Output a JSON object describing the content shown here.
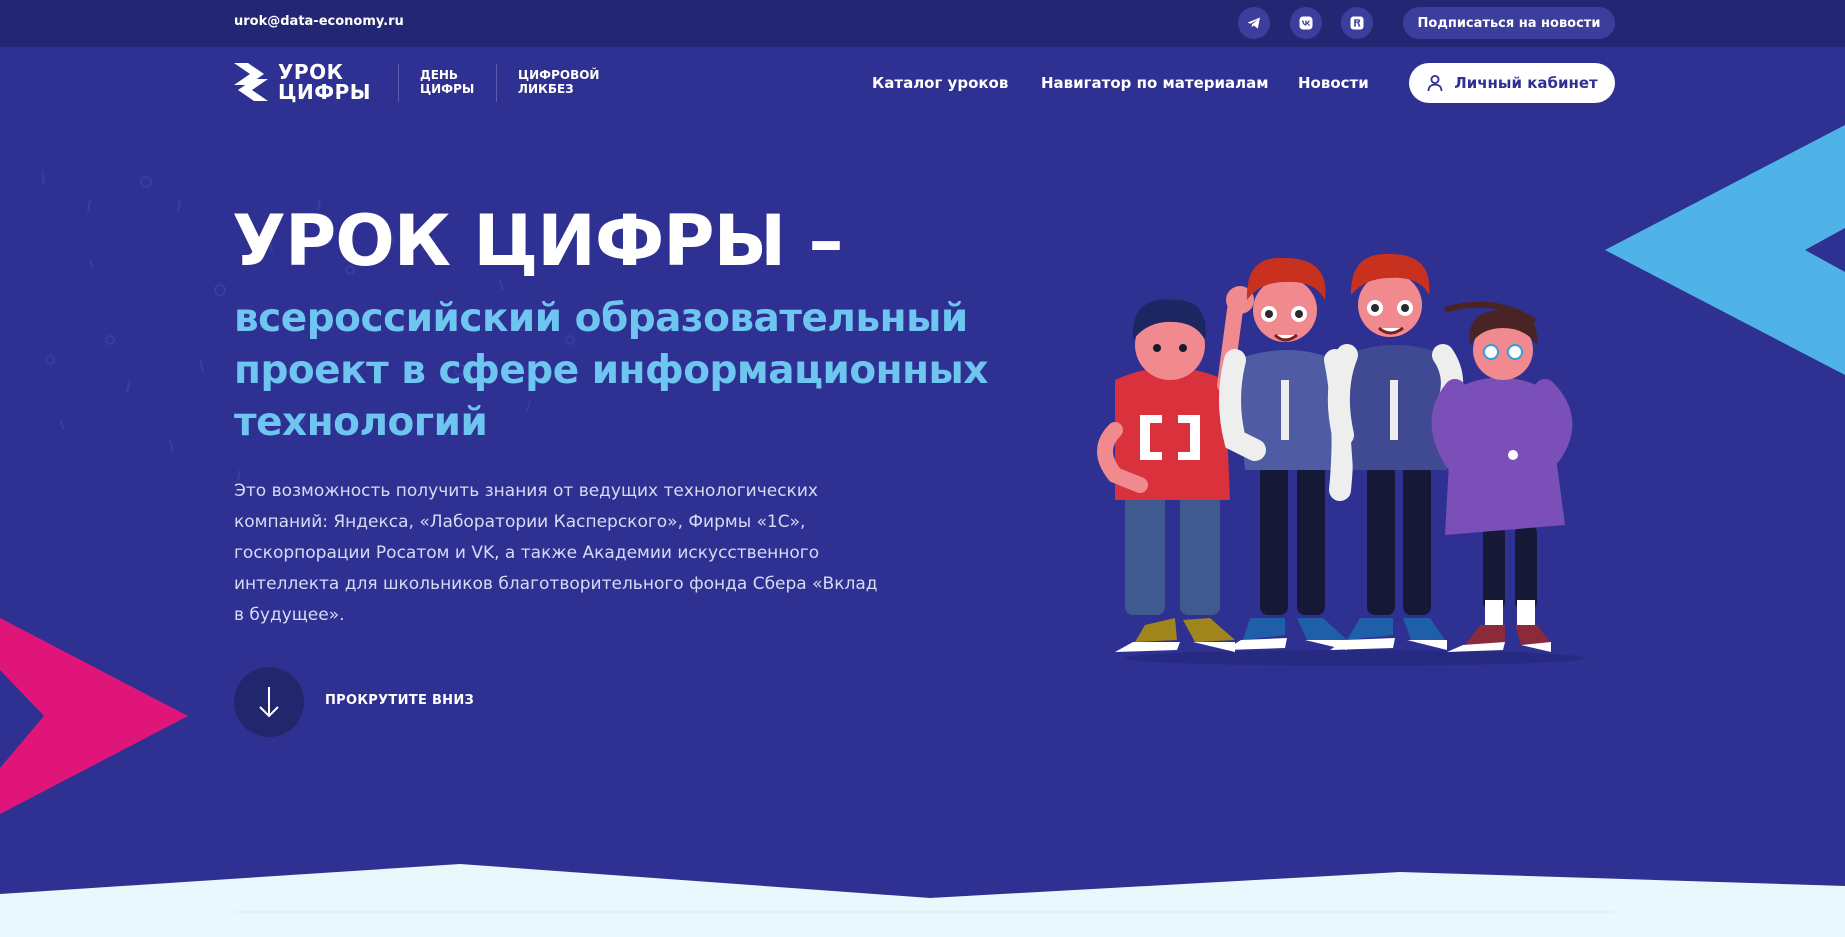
{
  "topbar": {
    "email": "urok@data-economy.ru",
    "socials": [
      {
        "name": "telegram-icon"
      },
      {
        "name": "vk-icon"
      },
      {
        "name": "rutube-icon"
      }
    ],
    "subscribe_label": "Подписаться на новости"
  },
  "header": {
    "logo_line1": "УРОК",
    "logo_line2": "ЦИФРЫ",
    "day_line1": "ДЕНЬ",
    "day_line2": "ЦИФРЫ",
    "likbez_line1": "ЦИФРОВОЙ",
    "likbez_line2": "ЛИКБЕЗ",
    "nav": [
      {
        "label": "Каталог уроков"
      },
      {
        "label": "Навигатор по материалам"
      },
      {
        "label": "Новости"
      }
    ],
    "cabinet_label": "Личный кабинет"
  },
  "hero": {
    "title": "УРОК ЦИФРЫ –",
    "subtitle": "всероссийский образовательный проект в сфере информационных технологий",
    "description": "Это возможность получить знания от ведущих технологических компаний: Яндекса, «Лаборатории Касперского», Фирмы «1С», госкорпорации Росатом и VK, а также Академии искусственного интеллекта для школьников благотворительного фонда Сбера «Вклад в будущее».",
    "scroll_label": "ПРОКРУТИТЕ ВНИЗ"
  },
  "colors": {
    "background": "#2e3192",
    "topbar": "#232673",
    "accent_blue": "#6ec6f0",
    "accent_pink": "#e0157a",
    "accent_cyan": "#4fb3e8",
    "bottom_section": "#eaf7fc"
  }
}
